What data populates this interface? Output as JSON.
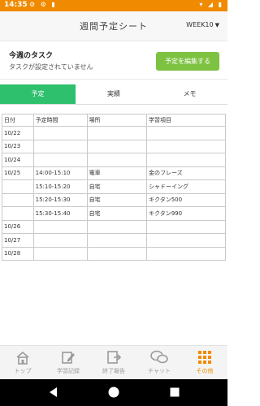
{
  "status": {
    "time": "14:35",
    "left_icons": "⚙ ⚙ ▮",
    "right_icons": "▾ ◢ ▮"
  },
  "header": {
    "title": "週間予定シート",
    "week": "WEEK10"
  },
  "task": {
    "title": "今週のタスク",
    "desc": "タスクが設定されていません",
    "edit_label": "予定を編集する"
  },
  "tabs": [
    {
      "label": "予定"
    },
    {
      "label": "実績"
    },
    {
      "label": "メモ"
    }
  ],
  "table": {
    "headers": [
      "日付",
      "予定時間",
      "場所",
      "学習項目"
    ],
    "rows": [
      [
        "10/22",
        "",
        "",
        ""
      ],
      [
        "10/23",
        "",
        "",
        ""
      ],
      [
        "10/24",
        "",
        "",
        ""
      ],
      [
        "10/25",
        "14:00-15:10",
        "電車",
        "金のフレーズ"
      ],
      [
        "",
        "15:10-15:20",
        "自宅",
        "シャドーイング"
      ],
      [
        "",
        "15:20-15:30",
        "自宅",
        "キクタン500"
      ],
      [
        "",
        "15:30-15:40",
        "自宅",
        "キクタン990"
      ],
      [
        "10/26",
        "",
        "",
        ""
      ],
      [
        "10/27",
        "",
        "",
        ""
      ],
      [
        "10/28",
        "",
        "",
        ""
      ]
    ]
  },
  "nav": [
    {
      "label": "トップ",
      "icon": "home-icon"
    },
    {
      "label": "学習記録",
      "icon": "edit-note-icon"
    },
    {
      "label": "終了報告",
      "icon": "report-icon"
    },
    {
      "label": "チャット",
      "icon": "chat-icon"
    },
    {
      "label": "その他",
      "icon": "grid-icon"
    }
  ],
  "colors": {
    "status_bar": "#f08a00",
    "active_tab": "#2ec06c",
    "edit_button": "#7ec242",
    "nav_active": "#f08a00"
  }
}
